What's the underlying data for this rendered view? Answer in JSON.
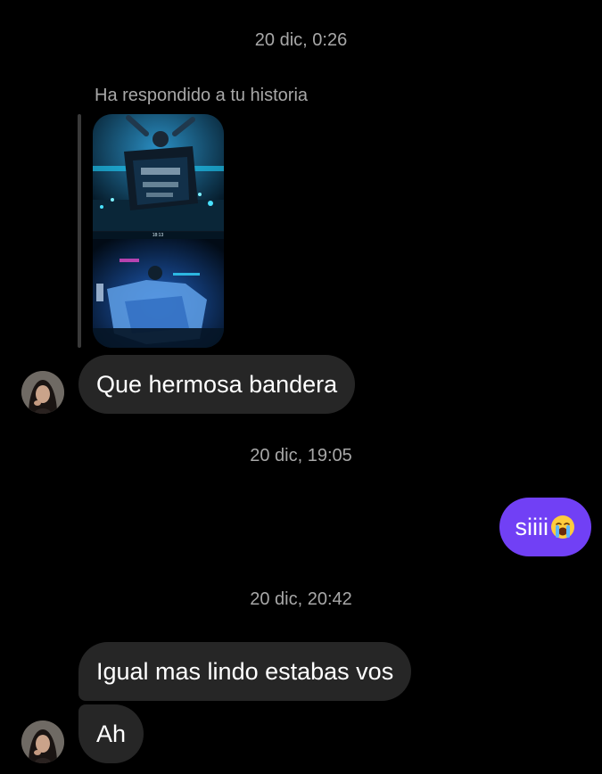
{
  "conversation": {
    "timestamp_1": "20 dic, 0:26",
    "story_reply_label": "Ha respondido a tu historia",
    "story_overlay_text": "18:13",
    "msg_1": "Que hermosa bandera",
    "timestamp_2": "20 dic, 19:05",
    "msg_2_text": "siiii",
    "msg_2_emoji": "loudly-crying-face-emoji",
    "timestamp_3": "20 dic, 20:42",
    "msg_3": "Igual mas lindo estabas vos",
    "msg_4": "Ah"
  },
  "colors": {
    "background": "#000000",
    "incoming_bubble": "#262626",
    "outgoing_bubble": "#7140f5",
    "timestamp_text": "#a8a8a8"
  }
}
